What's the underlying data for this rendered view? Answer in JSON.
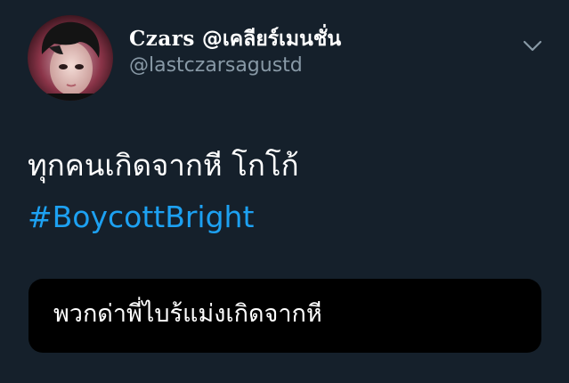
{
  "tweet": {
    "display_name_gothic": "Czars",
    "display_name_rest": "@เคลียร์เมนชั่น",
    "handle": "@lastczarsagustd",
    "text": "ทุกคนเกิดจากหี โกโก้",
    "hashtag": "#BoycottBright",
    "quoted_text": "พวกด่าพี่ไบร้แม่งเกิดจากหี"
  },
  "icons": {
    "avatar": "profile-avatar",
    "menu": "chevron-down-icon"
  },
  "colors": {
    "background": "#15202b",
    "text_primary": "#ffffff",
    "text_secondary": "#8899a6",
    "link": "#1da1f2",
    "quote_background": "#000000"
  }
}
